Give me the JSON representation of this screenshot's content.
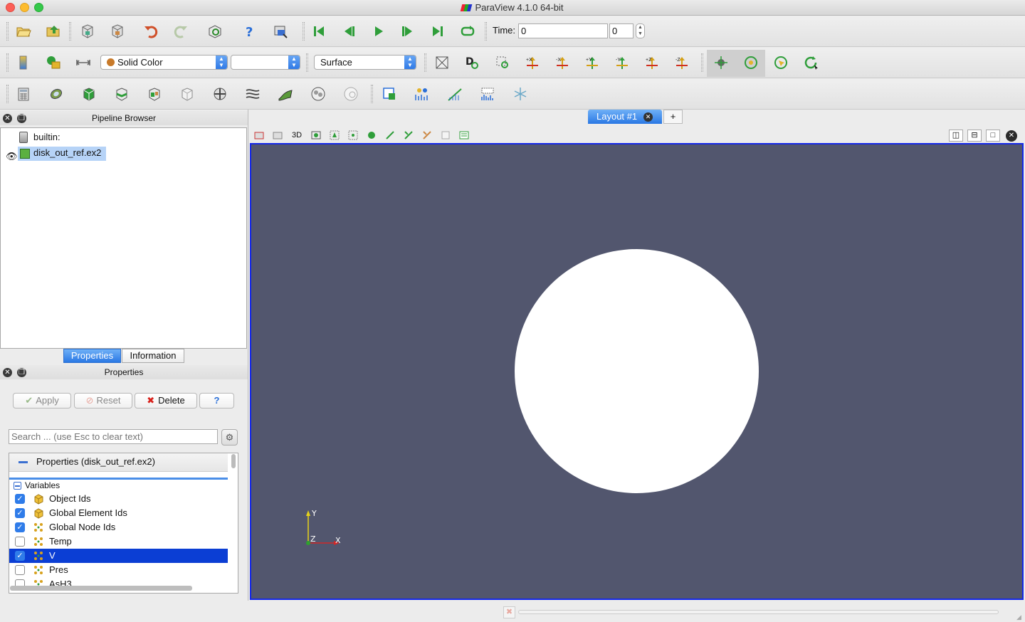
{
  "window": {
    "title": "ParaView 4.1.0 64-bit"
  },
  "colors": {
    "accent": "#2a78e4",
    "viewport_bg": "#52566e",
    "viewport_border": "#1428e8",
    "selection": "#0b3ed4",
    "close_red": "#fc5f57",
    "minimize_yellow": "#fdbc2e",
    "zoom_green": "#34c84a"
  },
  "toolbar": {
    "time_label": "Time:",
    "time_value": "0",
    "time_step": "0",
    "color_by": "Solid Color",
    "component": "",
    "representation": "Surface",
    "view_3d_label": "3D"
  },
  "pipeline": {
    "title": "Pipeline Browser",
    "root": "builtin:",
    "source": "disk_out_ref.ex2"
  },
  "tabs": {
    "properties": "Properties",
    "information": "Information"
  },
  "properties_panel": {
    "title": "Properties",
    "apply": "Apply",
    "reset": "Reset",
    "delete": "Delete",
    "help": "?",
    "search_placeholder": "Search ... (use Esc to clear text)",
    "section_title": "Properties (disk_out_ref.ex2)",
    "variables_header": "Variables",
    "variables": [
      {
        "name": "Object Ids",
        "checked": true,
        "icon": "cell-data-icon",
        "selected": false
      },
      {
        "name": "Global Element Ids",
        "checked": true,
        "icon": "cell-data-icon",
        "selected": false
      },
      {
        "name": "Global Node Ids",
        "checked": true,
        "icon": "point-data-icon",
        "selected": false
      },
      {
        "name": "Temp",
        "checked": false,
        "icon": "point-data-icon",
        "selected": false
      },
      {
        "name": "V",
        "checked": true,
        "icon": "point-data-icon",
        "selected": true
      },
      {
        "name": "Pres",
        "checked": false,
        "icon": "point-data-icon",
        "selected": false
      },
      {
        "name": "AsH3",
        "checked": false,
        "icon": "point-data-icon",
        "selected": false
      }
    ]
  },
  "layout": {
    "tab_label": "Layout #1",
    "add_tab": "+"
  },
  "axes": {
    "x": "X",
    "y": "Y",
    "z": "Z"
  }
}
